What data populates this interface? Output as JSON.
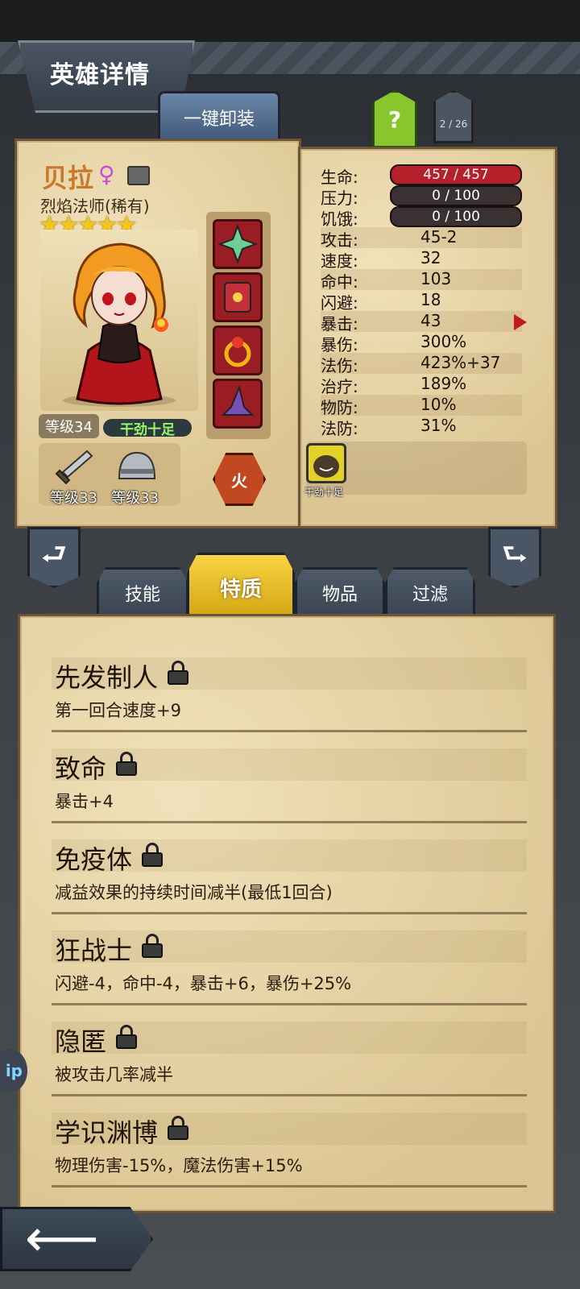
{
  "header": {
    "title": "英雄详情"
  },
  "toolbar": {
    "unequip_label": "一键卸装",
    "help_label": "?",
    "page_indicator": "2 / 26"
  },
  "hero": {
    "name": "贝拉",
    "gender_icon": "female-icon",
    "class": "烈焰法师(稀有)",
    "stars": "★★★★★",
    "level": "等级34",
    "status": "干劲十足",
    "weapon_level": "等级33",
    "armor_level": "等级33",
    "element": "火"
  },
  "stats": [
    {
      "label": "生命:",
      "value": "457 / 457",
      "kind": "bar",
      "color": "#b5202a"
    },
    {
      "label": "压力:",
      "value": "0 / 100",
      "kind": "bar",
      "color": "#3a3232"
    },
    {
      "label": "饥饿:",
      "value": "0 / 100",
      "kind": "bar",
      "color": "#3a3232"
    },
    {
      "label": "攻击:",
      "value": "45-2"
    },
    {
      "label": "速度:",
      "value": "32"
    },
    {
      "label": "命中:",
      "value": "103"
    },
    {
      "label": "闪避:",
      "value": "18"
    },
    {
      "label": "暴击:",
      "value": "43"
    },
    {
      "label": "暴伤:",
      "value": "300%"
    },
    {
      "label": "法伤:",
      "value": "423%+37"
    },
    {
      "label": "治疗:",
      "value": "189%"
    },
    {
      "label": "物防:",
      "value": "10%"
    },
    {
      "label": "法防:",
      "value": "31%"
    }
  ],
  "status_effect": {
    "label": "干劲十足",
    "icon": "smiling-blob-icon"
  },
  "tabs": [
    {
      "label": "技能"
    },
    {
      "label": "特质",
      "active": true
    },
    {
      "label": "物品"
    },
    {
      "label": "过滤"
    }
  ],
  "traits": [
    {
      "name": "先发制人",
      "desc": "第一回合速度+9"
    },
    {
      "name": "致命",
      "desc": "暴击+4"
    },
    {
      "name": "免疫体",
      "desc": "减益效果的持续时间减半(最低1回合)"
    },
    {
      "name": "狂战士",
      "desc": "闪避-4，命中-4，暴击+6，暴伤+25%"
    },
    {
      "name": "隐匿",
      "desc": "被攻击几率减半"
    },
    {
      "name": "学识渊博",
      "desc": "物理伤害-15%，魔法伤害+15%"
    }
  ],
  "side_bubble": "ip"
}
